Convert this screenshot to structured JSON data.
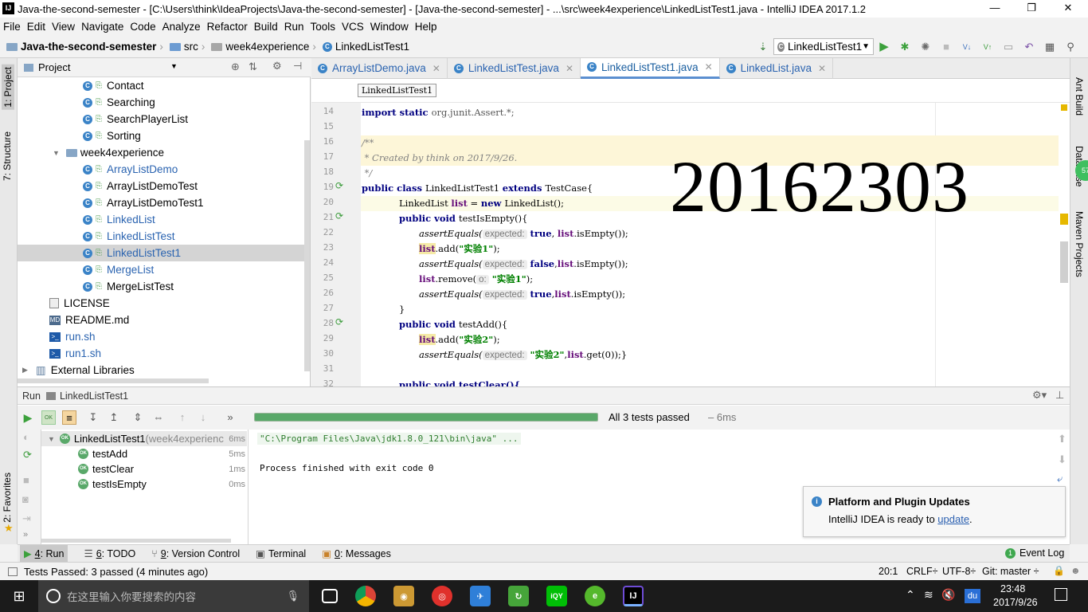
{
  "window": {
    "title": "Java-the-second-semester - [C:\\Users\\think\\IdeaProjects\\Java-the-second-semester] - [Java-the-second-semester] - ...\\src\\week4experience\\LinkedListTest1.java - IntelliJ IDEA 2017.1.2",
    "controls": [
      "—",
      "❐",
      "✕"
    ]
  },
  "menu": [
    "File",
    "Edit",
    "View",
    "Navigate",
    "Code",
    "Analyze",
    "Refactor",
    "Build",
    "Run",
    "Tools",
    "VCS",
    "Window",
    "Help"
  ],
  "breadcrumb": [
    "Java-the-second-semester",
    "src",
    "week4experience",
    "LinkedListTest1"
  ],
  "run_config": "LinkedListTest1",
  "project_panel": {
    "title": "Project",
    "items": [
      {
        "label": "Contact",
        "kind": "class",
        "level": 3
      },
      {
        "label": "Searching",
        "kind": "class",
        "level": 3
      },
      {
        "label": "SearchPlayerList",
        "kind": "class",
        "level": 3
      },
      {
        "label": "Sorting",
        "kind": "class",
        "level": 3
      },
      {
        "label": "week4experience",
        "kind": "folder",
        "level": 2
      },
      {
        "label": "ArrayListDemo",
        "kind": "class-blue",
        "level": 3
      },
      {
        "label": "ArrayListDemoTest",
        "kind": "class",
        "level": 3
      },
      {
        "label": "ArrayListDemoTest1",
        "kind": "class",
        "level": 3
      },
      {
        "label": "LinkedList",
        "kind": "class-blue",
        "level": 3
      },
      {
        "label": "LinkedListTest",
        "kind": "class-blue",
        "level": 3
      },
      {
        "label": "LinkedListTest1",
        "kind": "class-blue",
        "level": 3,
        "selected": true
      },
      {
        "label": "MergeList",
        "kind": "class-blue",
        "level": 3
      },
      {
        "label": "MergeListTest",
        "kind": "class",
        "level": 3
      },
      {
        "label": "LICENSE",
        "kind": "file",
        "level": 1
      },
      {
        "label": "README.md",
        "kind": "md",
        "level": 1
      },
      {
        "label": "run.sh",
        "kind": "sh",
        "level": 1
      },
      {
        "label": "run1.sh",
        "kind": "sh",
        "level": 1
      },
      {
        "label": "External Libraries",
        "kind": "lib",
        "level": 0
      }
    ]
  },
  "editor": {
    "tabs": [
      {
        "label": "ArrayListDemo.java",
        "active": false
      },
      {
        "label": "LinkedListTest.java",
        "active": false
      },
      {
        "label": "LinkedListTest1.java",
        "active": true
      },
      {
        "label": "LinkedList.java",
        "active": false
      }
    ],
    "breadcrumb_tag": "LinkedListTest1",
    "line_numbers": [
      "14",
      "15",
      "16",
      "17",
      "18",
      "19",
      "20",
      "21",
      "22",
      "23",
      "24",
      "25",
      "26",
      "27",
      "28",
      "29",
      "30",
      "31",
      "32"
    ],
    "overlay_text": "20162303",
    "code": {
      "l14_a": "import static ",
      "l14_b": "org.junit.Assert.*;",
      "l16": "/**",
      "l17": " * Created by think on 2017/9/26.",
      "l18": " */",
      "l19_a": "public class ",
      "l19_b": "LinkedListTest1 ",
      "l19_c": "extends ",
      "l19_d": "TestCase{",
      "l20_a": "LinkedList ",
      "l20_b": "list",
      "l20_c": " = ",
      "l20_d": "new ",
      "l20_e": "LinkedList();",
      "l21_a": "public void ",
      "l21_b": "testIsEmpty(){",
      "l22_a": "assertEquals(",
      "l22_hint": "expected:",
      "l22_b": " true",
      "l22_c": ", ",
      "l22_d": "list",
      "l22_e": ".isEmpty());",
      "l23_a": "list",
      "l23_b": ".add(",
      "l23_c": "\"实验1\"",
      "l23_d": ");",
      "l24_a": "assertEquals(",
      "l24_hint": "expected:",
      "l24_b": " false",
      "l24_c": ",",
      "l24_d": "list",
      "l24_e": ".isEmpty());",
      "l25_a": "list",
      "l25_b": ".remove(",
      "l25_hint": "o:",
      "l25_c": " \"实验1\"",
      "l25_d": ");",
      "l26_a": "assertEquals(",
      "l26_hint": "expected:",
      "l26_b": " true",
      "l26_c": ",",
      "l26_d": "list",
      "l26_e": ".isEmpty());",
      "l27": "}",
      "l28_a": "public void ",
      "l28_b": "testAdd(){",
      "l29_a": "list",
      "l29_b": ".add(",
      "l29_c": "\"实验2\"",
      "l29_d": ");",
      "l30_a": "assertEquals(",
      "l30_hint": "expected:",
      "l30_b": " \"实验2\"",
      "l30_c": ",",
      "l30_d": "list",
      "l30_e": ".get(0));}",
      "l32": "public void testClear(){"
    }
  },
  "run_panel": {
    "header_label": "Run",
    "header_config": "LinkedListTest1",
    "progress": 1.0,
    "summary": "All 3 tests passed",
    "summary_time": "– 6ms",
    "tests": [
      {
        "name": "LinkedListTest1",
        "suffix": "(week4experienc",
        "time": "6ms",
        "root": true
      },
      {
        "name": "testAdd",
        "suffix": "",
        "time": "5ms",
        "root": false
      },
      {
        "name": "testClear",
        "suffix": "",
        "time": "1ms",
        "root": false
      },
      {
        "name": "testIsEmpty",
        "suffix": "",
        "time": "0ms",
        "root": false
      }
    ],
    "console": [
      "\"C:\\Program Files\\Java\\jdk1.8.0_121\\bin\\java\" ...",
      "",
      "Process finished with exit code 0"
    ]
  },
  "notification": {
    "title": "Platform and Plugin Updates",
    "body": "IntelliJ IDEA is ready to ",
    "link": "update",
    "end": "."
  },
  "bottom_tabs": [
    {
      "num": "4",
      "label": ": Run",
      "active": true
    },
    {
      "num": "6",
      "label": ": TODO",
      "active": false
    },
    {
      "num": "9",
      "label": ": Version Control",
      "active": false
    },
    {
      "num": "",
      "label": "Terminal",
      "active": false
    },
    {
      "num": "0",
      "label": ": Messages",
      "active": false
    }
  ],
  "event_log": {
    "badge": "1",
    "label": "Event Log"
  },
  "status": {
    "message": "Tests Passed: 3 passed (4 minutes ago)",
    "position": "20:1",
    "line_sep": "CRLF÷",
    "encoding": "UTF-8÷",
    "git": "Git: master ÷"
  },
  "left_tool_tabs": [
    "1: Project",
    "7: Structure",
    "2: Favorites"
  ],
  "right_tool_tabs": [
    "Ant Build",
    "Database",
    "Maven Projects"
  ],
  "right_badge": "57",
  "taskbar": {
    "search_placeholder": "在这里输入你要搜索的内容",
    "time": "23:48",
    "date": "2017/9/26",
    "ime": "du"
  },
  "colors": {
    "accent": "#3a83c7",
    "test_ok": "#59a869",
    "progress": "#59a869",
    "keyword": "#000080",
    "string": "#008000"
  }
}
